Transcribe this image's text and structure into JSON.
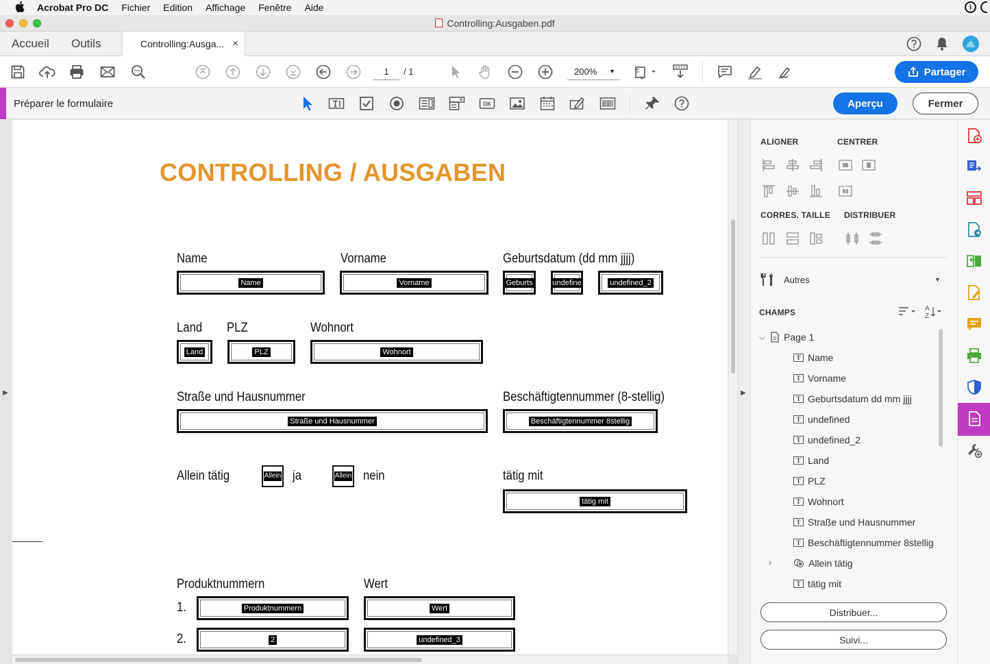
{
  "menubar": {
    "app": "Acrobat Pro DC",
    "items": [
      "Fichier",
      "Edition",
      "Affichage",
      "Fenêtre",
      "Aide"
    ]
  },
  "window": {
    "title": "Controlling:Ausgaben.pdf"
  },
  "tabs": {
    "home": "Accueil",
    "tools": "Outils",
    "document": "Controlling:Ausga...",
    "close_glyph": "×"
  },
  "toolbar": {
    "page_current": "1",
    "page_total": "/ 1",
    "zoom": "200%",
    "share_label": "Partager"
  },
  "formbar": {
    "title": "Préparer le formulaire",
    "preview_label": "Aperçu",
    "close_label": "Fermer"
  },
  "document": {
    "title": "CONTROLLING / AUSGABEN",
    "labels": {
      "name": "Name",
      "vorname": "Vorname",
      "geburtsdatum": "Geburtsdatum (dd mm jjjj)",
      "land": "Land",
      "plz": "PLZ",
      "wohnort": "Wohnort",
      "strasse": "Straße und Hausnummer",
      "beschaeftigten": "Beschäftigtennummer (8-stellig)",
      "allein": "Allein tätig",
      "ja": "ja",
      "nein": "nein",
      "taetig": "tätig mit",
      "produkt": "Produktnummern",
      "wert": "Wert",
      "n1": "1.",
      "n2": "2."
    },
    "fields": {
      "name": "Name",
      "vorname": "Vorname",
      "geburts": "Geburts",
      "undefined": "undefine",
      "undefined_2": "undefined_2",
      "land": "Land",
      "plz": "PLZ",
      "wohnort": "Wohnort",
      "strasse": "Straße und Hausnummer",
      "beschaeftigten": "Beschäftigtennummer 8stellig",
      "allein_ja": "Allein",
      "allein_nein": "Allein",
      "taetig": "tätig mit",
      "produkt": "Produktnummern",
      "wert": "Wert",
      "p2": "2",
      "undefined_3": "undefined_3"
    }
  },
  "panel": {
    "align": "ALIGNER",
    "center": "CENTRER",
    "size": "CORRES. TAILLE",
    "distribute": "DISTRIBUER",
    "others": "Autres",
    "fields_heading": "CHAMPS",
    "tree_root": "Page 1",
    "tree_items": [
      "Name",
      "Vorname",
      "Geburtsdatum dd mm jjjj",
      "undefined",
      "undefined_2",
      "Land",
      "PLZ",
      "Wohnort",
      "Straße und Hausnummer",
      "Beschäftigtennummer 8stellig",
      "Allein tätig",
      "tätig mit"
    ],
    "distribute_btn": "Distribuer...",
    "track_btn": "Suivi..."
  },
  "colors": {
    "accent": "#1473e6",
    "form_mode": "#c03bc4",
    "title_orange": "#e3952c"
  }
}
